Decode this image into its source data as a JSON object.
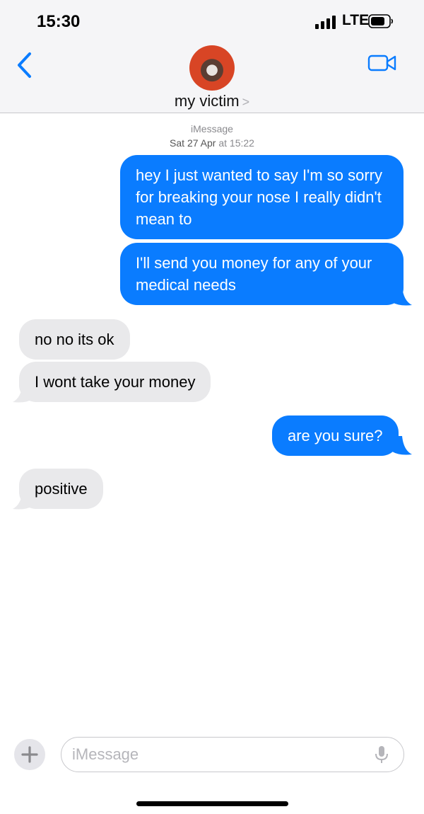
{
  "status_bar": {
    "time": "15:30",
    "network": "LTE"
  },
  "header": {
    "contact_name": "my victim",
    "chevron": ">"
  },
  "thread_meta": {
    "service": "iMessage",
    "date": "Sat 27 Apr",
    "at": "at",
    "time": "15:22"
  },
  "messages": [
    {
      "direction": "outgoing",
      "text": "hey I just wanted to say I'm so sorry for breaking your nose I really didn't mean to"
    },
    {
      "direction": "outgoing",
      "text": "I'll send you money for any of your medical needs"
    },
    {
      "direction": "incoming",
      "text": "no no its ok"
    },
    {
      "direction": "incoming",
      "text": "I wont take your money"
    },
    {
      "direction": "outgoing",
      "text": "are you sure?"
    },
    {
      "direction": "incoming",
      "text": "positive"
    }
  ],
  "input": {
    "placeholder": "iMessage",
    "add_symbol": "+"
  },
  "colors": {
    "outgoing_bubble": "#0a7cff",
    "incoming_bubble": "#e9e9eb",
    "accent": "#0a7cff"
  },
  "icons": [
    "back-chevron-icon",
    "video-camera-icon",
    "signal-icon",
    "battery-icon",
    "plus-icon",
    "microphone-icon"
  ]
}
